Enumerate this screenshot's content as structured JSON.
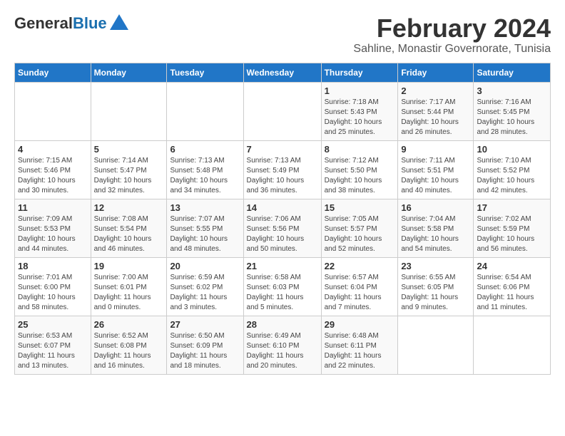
{
  "logo": {
    "part1": "General",
    "part2": "Blue"
  },
  "title": "February 2024",
  "subtitle": "Sahline, Monastir Governorate, Tunisia",
  "days_of_week": [
    "Sunday",
    "Monday",
    "Tuesday",
    "Wednesday",
    "Thursday",
    "Friday",
    "Saturday"
  ],
  "weeks": [
    [
      {
        "day": "",
        "info": ""
      },
      {
        "day": "",
        "info": ""
      },
      {
        "day": "",
        "info": ""
      },
      {
        "day": "",
        "info": ""
      },
      {
        "day": "1",
        "info": "Sunrise: 7:18 AM\nSunset: 5:43 PM\nDaylight: 10 hours\nand 25 minutes."
      },
      {
        "day": "2",
        "info": "Sunrise: 7:17 AM\nSunset: 5:44 PM\nDaylight: 10 hours\nand 26 minutes."
      },
      {
        "day": "3",
        "info": "Sunrise: 7:16 AM\nSunset: 5:45 PM\nDaylight: 10 hours\nand 28 minutes."
      }
    ],
    [
      {
        "day": "4",
        "info": "Sunrise: 7:15 AM\nSunset: 5:46 PM\nDaylight: 10 hours\nand 30 minutes."
      },
      {
        "day": "5",
        "info": "Sunrise: 7:14 AM\nSunset: 5:47 PM\nDaylight: 10 hours\nand 32 minutes."
      },
      {
        "day": "6",
        "info": "Sunrise: 7:13 AM\nSunset: 5:48 PM\nDaylight: 10 hours\nand 34 minutes."
      },
      {
        "day": "7",
        "info": "Sunrise: 7:13 AM\nSunset: 5:49 PM\nDaylight: 10 hours\nand 36 minutes."
      },
      {
        "day": "8",
        "info": "Sunrise: 7:12 AM\nSunset: 5:50 PM\nDaylight: 10 hours\nand 38 minutes."
      },
      {
        "day": "9",
        "info": "Sunrise: 7:11 AM\nSunset: 5:51 PM\nDaylight: 10 hours\nand 40 minutes."
      },
      {
        "day": "10",
        "info": "Sunrise: 7:10 AM\nSunset: 5:52 PM\nDaylight: 10 hours\nand 42 minutes."
      }
    ],
    [
      {
        "day": "11",
        "info": "Sunrise: 7:09 AM\nSunset: 5:53 PM\nDaylight: 10 hours\nand 44 minutes."
      },
      {
        "day": "12",
        "info": "Sunrise: 7:08 AM\nSunset: 5:54 PM\nDaylight: 10 hours\nand 46 minutes."
      },
      {
        "day": "13",
        "info": "Sunrise: 7:07 AM\nSunset: 5:55 PM\nDaylight: 10 hours\nand 48 minutes."
      },
      {
        "day": "14",
        "info": "Sunrise: 7:06 AM\nSunset: 5:56 PM\nDaylight: 10 hours\nand 50 minutes."
      },
      {
        "day": "15",
        "info": "Sunrise: 7:05 AM\nSunset: 5:57 PM\nDaylight: 10 hours\nand 52 minutes."
      },
      {
        "day": "16",
        "info": "Sunrise: 7:04 AM\nSunset: 5:58 PM\nDaylight: 10 hours\nand 54 minutes."
      },
      {
        "day": "17",
        "info": "Sunrise: 7:02 AM\nSunset: 5:59 PM\nDaylight: 10 hours\nand 56 minutes."
      }
    ],
    [
      {
        "day": "18",
        "info": "Sunrise: 7:01 AM\nSunset: 6:00 PM\nDaylight: 10 hours\nand 58 minutes."
      },
      {
        "day": "19",
        "info": "Sunrise: 7:00 AM\nSunset: 6:01 PM\nDaylight: 11 hours\nand 0 minutes."
      },
      {
        "day": "20",
        "info": "Sunrise: 6:59 AM\nSunset: 6:02 PM\nDaylight: 11 hours\nand 3 minutes."
      },
      {
        "day": "21",
        "info": "Sunrise: 6:58 AM\nSunset: 6:03 PM\nDaylight: 11 hours\nand 5 minutes."
      },
      {
        "day": "22",
        "info": "Sunrise: 6:57 AM\nSunset: 6:04 PM\nDaylight: 11 hours\nand 7 minutes."
      },
      {
        "day": "23",
        "info": "Sunrise: 6:55 AM\nSunset: 6:05 PM\nDaylight: 11 hours\nand 9 minutes."
      },
      {
        "day": "24",
        "info": "Sunrise: 6:54 AM\nSunset: 6:06 PM\nDaylight: 11 hours\nand 11 minutes."
      }
    ],
    [
      {
        "day": "25",
        "info": "Sunrise: 6:53 AM\nSunset: 6:07 PM\nDaylight: 11 hours\nand 13 minutes."
      },
      {
        "day": "26",
        "info": "Sunrise: 6:52 AM\nSunset: 6:08 PM\nDaylight: 11 hours\nand 16 minutes."
      },
      {
        "day": "27",
        "info": "Sunrise: 6:50 AM\nSunset: 6:09 PM\nDaylight: 11 hours\nand 18 minutes."
      },
      {
        "day": "28",
        "info": "Sunrise: 6:49 AM\nSunset: 6:10 PM\nDaylight: 11 hours\nand 20 minutes."
      },
      {
        "day": "29",
        "info": "Sunrise: 6:48 AM\nSunset: 6:11 PM\nDaylight: 11 hours\nand 22 minutes."
      },
      {
        "day": "",
        "info": ""
      },
      {
        "day": "",
        "info": ""
      }
    ]
  ]
}
